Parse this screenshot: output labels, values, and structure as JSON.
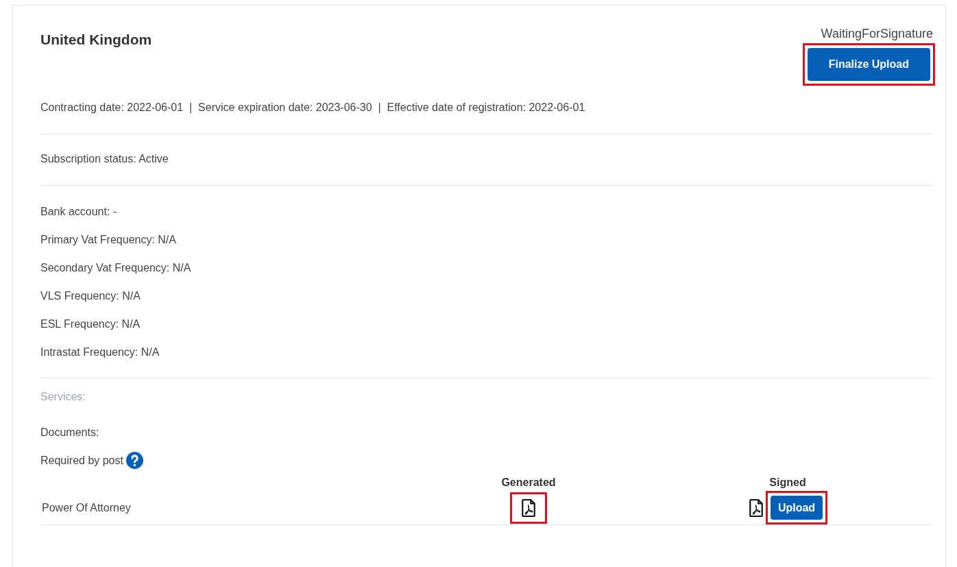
{
  "card": {
    "title": "United Kingdom",
    "status": "WaitingForSignature",
    "finalize_button": {
      "label": "Finalize Upload",
      "highlighted": true
    },
    "dates": "Contracting date: 2022-06-01  |  Service expiration date: 2023-06-30  |  Effective date of registration: 2022-06-01",
    "subscription_status": "Subscription status: Active",
    "details": [
      "Bank account: -",
      "Primary Vat Frequency: N/A",
      "Secondary Vat Frequency: N/A",
      "VLS Frequency: N/A",
      "ESL Frequency: N/A",
      "Intrastat Frequency: N/A"
    ],
    "services": {
      "label": "Services:",
      "disabled": true
    },
    "documents_label": "Documents:",
    "required_by_post": "Required by post",
    "documents_table": {
      "columns": [
        "Generated",
        "Signed"
      ],
      "rows": [
        {
          "name": "Power Of Attorney",
          "generated": {
            "has_file": true,
            "highlighted": true
          },
          "signed": {
            "has_file": true,
            "upload_label": "Upload",
            "highlighted": true
          }
        }
      ]
    }
  }
}
